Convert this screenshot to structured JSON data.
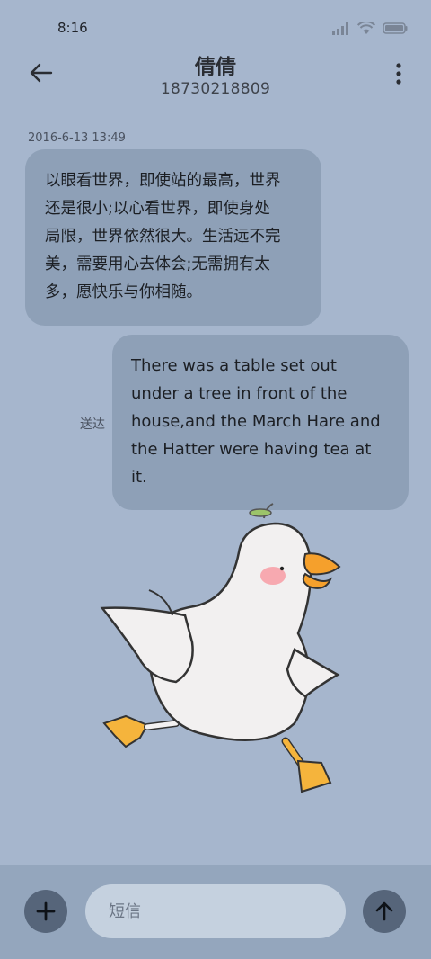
{
  "status_bar": {
    "time": "8:16",
    "icons": [
      "signal-icon",
      "wifi-icon",
      "battery-icon"
    ]
  },
  "header": {
    "contact_name": "倩倩",
    "phone_number": "18730218809",
    "back_icon": "back-arrow-icon",
    "menu_icon": "more-vertical-icon"
  },
  "messages": [
    {
      "direction": "incoming",
      "timestamp": "2016-6-13 13:49",
      "lines": [
        "以眼看世界，即使站的最高，世界",
        "还是很小;以心看世界，即使身处",
        "局限，世界依然很大。生活远不完",
        "美，需要用心去体会;无需拥有太",
        "多，愿快乐与你相随。"
      ]
    },
    {
      "direction": "outgoing",
      "status": "送达",
      "lines": [
        "There was a table set out",
        "under a tree in front of the",
        "house,and the March Hare and",
        "the Hatter were having tea at",
        "it."
      ]
    }
  ],
  "composer": {
    "placeholder": "短信",
    "value": "",
    "add_icon": "plus-icon",
    "send_icon": "send-arrow-icon"
  },
  "colors": {
    "background": "#a6b6cd",
    "bubble": "#8ea0b7",
    "bottom_bar": "#94a6bd",
    "input": "#c5d1df",
    "button": "#56657a"
  }
}
